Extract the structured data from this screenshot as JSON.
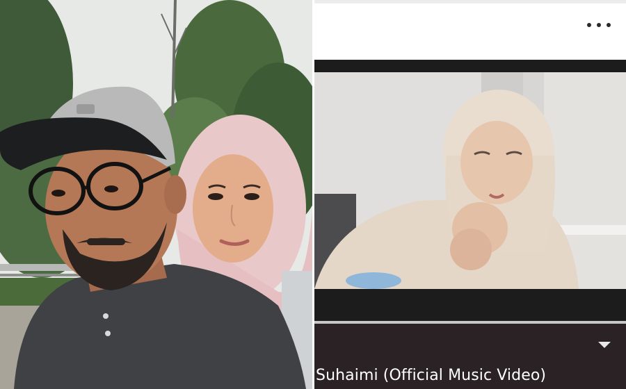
{
  "left_photo": {
    "subject": "selfie-of-couple-outdoors"
  },
  "video": {
    "title": "Suhaimi (Official Music Video)",
    "progress_fraction": 1.0,
    "more_icon": "more-horizontal-icon",
    "expand_icon": "chevron-down-icon"
  },
  "colors": {
    "player_background": "#1c1c1c",
    "info_panel": "#2a2224",
    "progress_track": "#5b5b5b",
    "progress_fill": "#c7c7c7",
    "title_text": "#ffffff"
  }
}
